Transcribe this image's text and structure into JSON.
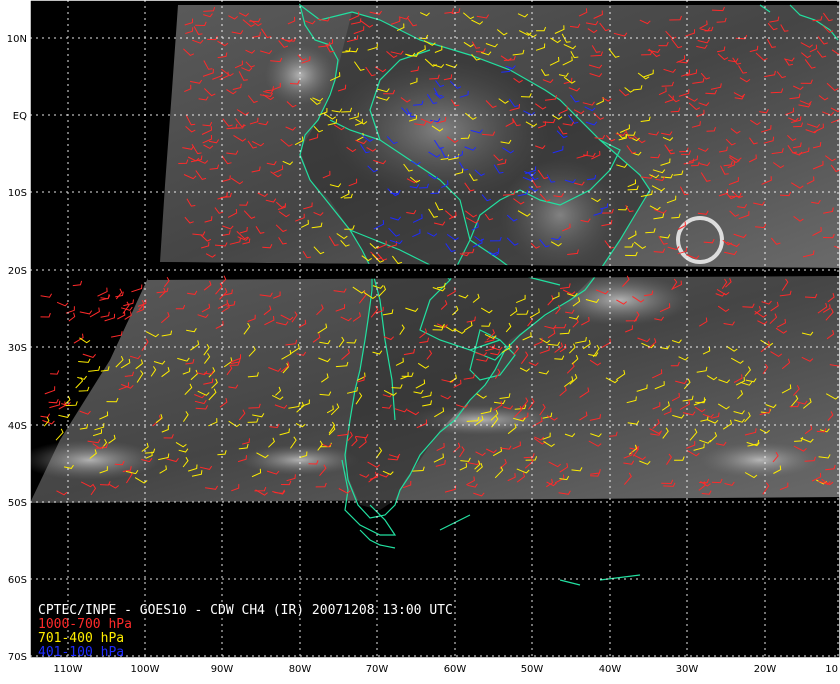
{
  "map": {
    "title": "CPTEC/INPE - GOES10 - CDW CH4 (IR) 20071208 13:00 UTC",
    "legend": [
      {
        "label": "1000-700 hPa",
        "color": "#ff2a2a"
      },
      {
        "label": "701-400 hPa",
        "color": "#ffee00"
      },
      {
        "label": "401-100 hPa",
        "color": "#1e2cff"
      }
    ],
    "lat_labels": [
      "10N",
      "EQ",
      "10S",
      "20S",
      "30S",
      "40S",
      "50S",
      "60S",
      "70S"
    ],
    "lon_labels": [
      "110W",
      "100W",
      "90W",
      "80W",
      "70W",
      "60W",
      "50W",
      "40W",
      "30W",
      "20W",
      "10"
    ],
    "colors": {
      "background": "#000000",
      "coastline": "#22e0a0",
      "grid": "#ffffff",
      "frame": "#ffffff"
    }
  }
}
